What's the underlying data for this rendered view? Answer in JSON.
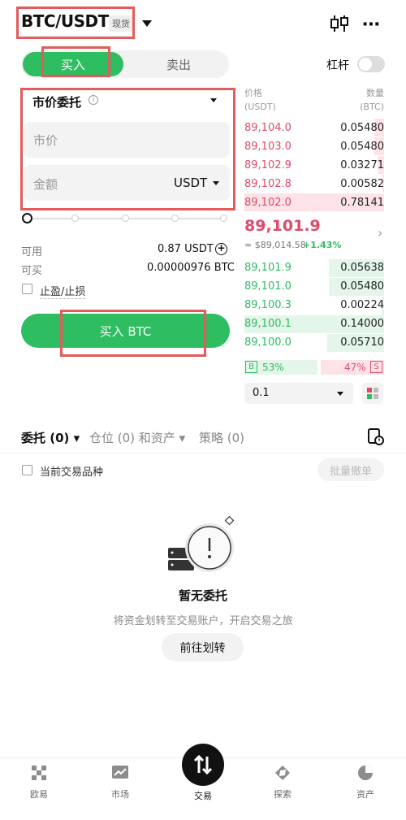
{
  "header": {
    "pair": "BTC/USDT",
    "tag": "现货"
  },
  "trade": {
    "buy_tab": "买入",
    "sell_tab": "卖出",
    "leverage_label": "杠杆",
    "order_type": "市价委托",
    "price_placeholder": "市价",
    "amount_placeholder": "金额",
    "amount_unit": "USDT",
    "available_label": "可用",
    "available_value": "0.87 USDT",
    "can_buy_label": "可买",
    "can_buy_value": "0.00000976 BTC",
    "tpsl_label": "止盈/止损",
    "buy_button": "买入 BTC"
  },
  "orderbook": {
    "price_header": "价格",
    "price_unit": "(USDT)",
    "qty_header": "数量",
    "qty_unit": "(BTC)",
    "asks": [
      {
        "price": "89,104.0",
        "qty": "0.05480"
      },
      {
        "price": "89,103.0",
        "qty": "0.05480"
      },
      {
        "price": "89,102.9",
        "qty": "0.03271"
      },
      {
        "price": "89,102.8",
        "qty": "0.00582"
      },
      {
        "price": "89,102.0",
        "qty": "0.78141"
      }
    ],
    "last_price": "89,101.9",
    "index_price": "≈ $89,014.58",
    "change": "+1.43%",
    "bids": [
      {
        "price": "89,101.9",
        "qty": "0.05638"
      },
      {
        "price": "89,101.0",
        "qty": "0.05480"
      },
      {
        "price": "89,100.3",
        "qty": "0.00224"
      },
      {
        "price": "89,100.1",
        "qty": "0.14000"
      },
      {
        "price": "89,100.0",
        "qty": "0.05710"
      }
    ],
    "buy_ratio_label": "B",
    "buy_ratio": "53%",
    "sell_ratio": "47%",
    "sell_ratio_label": "S",
    "depth": "0.1"
  },
  "orders": {
    "tab_orders": "委托 (0)",
    "tab_positions": "仓位 (0) 和资产",
    "tab_strategy": "策略 (0)",
    "current_only": "当前交易品种",
    "batch_cancel": "批量撤单",
    "empty_title": "暂无委托",
    "empty_sub": "将资金划转至交易账户，开启交易之旅",
    "transfer_button": "前往划转"
  },
  "nav": {
    "items": [
      "欧易",
      "市场",
      "交易",
      "探索",
      "资产"
    ]
  }
}
